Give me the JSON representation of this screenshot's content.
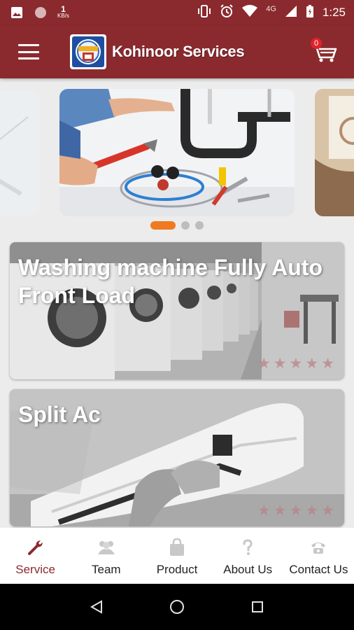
{
  "status_bar": {
    "speed_value": "1",
    "speed_unit": "KB/s",
    "network": "4G",
    "time": "1:25"
  },
  "app_bar": {
    "title": "Kohinoor Services",
    "cart_count": "0"
  },
  "carousel": {
    "active_index": 0,
    "dot_count": 3
  },
  "services": [
    {
      "title": "Washing machine Fully Auto Front Load",
      "rating_stars": 5
    },
    {
      "title": "Split Ac",
      "rating_stars": 5
    }
  ],
  "tabs": [
    {
      "label": "Service",
      "icon": "wrench-icon",
      "active": true
    },
    {
      "label": "Team",
      "icon": "team-icon",
      "active": false
    },
    {
      "label": "Product",
      "icon": "bag-icon",
      "active": false
    },
    {
      "label": "About Us",
      "icon": "question-icon",
      "active": false
    },
    {
      "label": "Contact Us",
      "icon": "phone-icon",
      "active": false
    }
  ],
  "colors": {
    "brand": "#8a2a2e",
    "accent": "#f07a20",
    "tab_active": "#8a2a2e",
    "tab_inactive_icon": "#c8c8c8"
  }
}
